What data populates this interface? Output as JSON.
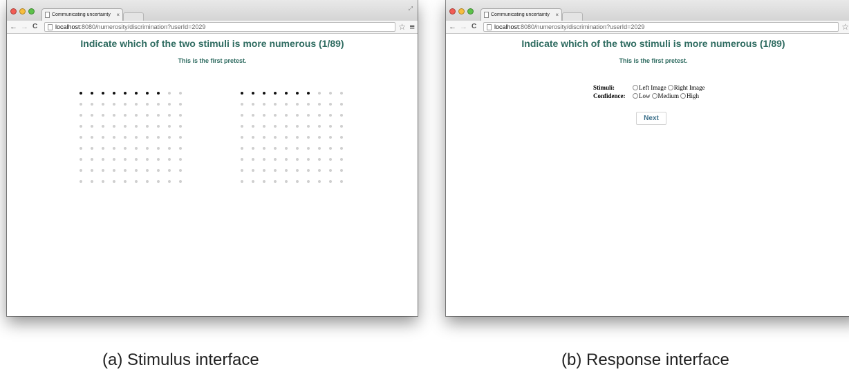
{
  "window_a": {
    "tab_title": "Communicating uncertainty",
    "tab_close": "×",
    "url_host": "localhost",
    "url_path": ":8080/numerosity/discrimination?userId=2029",
    "heading": "Indicate which of the two stimuli is more numerous (1/89)",
    "subheading": "This is the first pretest.",
    "stimuli": [
      {
        "name": "left",
        "rows": 9,
        "cols": 10,
        "black_dots": 8
      },
      {
        "name": "right",
        "rows": 9,
        "cols": 10,
        "black_dots": 7
      }
    ],
    "caption": "(a) Stimulus interface"
  },
  "window_b": {
    "tab_title": "Communicating uncertainty",
    "tab_close": "×",
    "url_host": "localhost",
    "url_path": ":8080/numerosity/discrimination?userId=2029",
    "heading": "Indicate which of the two stimuli is more numerous (1/89)",
    "subheading": "This is the first pretest.",
    "form": {
      "stimuli_label": "Stimuli:",
      "stimuli_options": [
        "Left Image",
        "Right Image"
      ],
      "confidence_label": "Confidence:",
      "confidence_options": [
        "Low",
        "Medium",
        "High"
      ]
    },
    "next_label": "Next",
    "caption": "(b) Response interface"
  },
  "icons": {
    "back": "←",
    "forward": "→",
    "reload": "C",
    "star": "☆",
    "menu": "≡",
    "expand": "⤢"
  },
  "colors": {
    "heading": "#2e6b60",
    "dot_active": "#111111",
    "dot_inactive": "#cfcfcf",
    "next_text": "#3b6f8a"
  }
}
